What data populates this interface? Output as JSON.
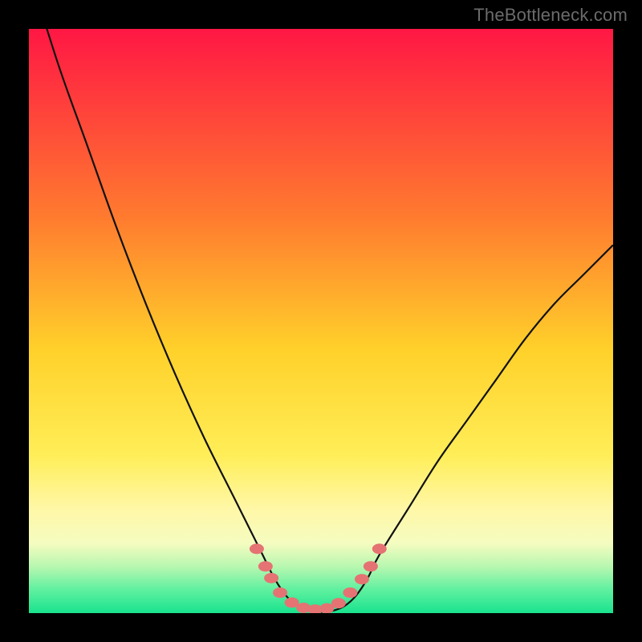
{
  "watermark": "TheBottleneck.com",
  "colors": {
    "bg_top": "#ff1744",
    "bg_mid_upper": "#ff7a2f",
    "bg_mid": "#ffd12a",
    "bg_lower": "#ffee58",
    "bg_pale": "#fff7a6",
    "bg_paler": "#f5fcc0",
    "bg_green1": "#b8f7b0",
    "bg_green2": "#5ff0a0",
    "bg_green3": "#19e38e",
    "curve": "#111111",
    "marker_fill": "#e57373",
    "marker_stroke": "#d85a5a",
    "frame": "#000000"
  },
  "chart_data": {
    "type": "line",
    "title": "",
    "xlabel": "",
    "ylabel": "",
    "xlim": [
      0,
      100
    ],
    "ylim": [
      0,
      100
    ],
    "series": [
      {
        "name": "bottleneck-curve",
        "x": [
          0,
          5,
          10,
          15,
          20,
          25,
          30,
          35,
          38,
          40,
          42,
          44,
          46,
          48,
          50,
          52,
          54,
          56,
          58,
          60,
          65,
          70,
          75,
          80,
          85,
          90,
          95,
          100
        ],
        "y": [
          110,
          94,
          80,
          66,
          53,
          41,
          30,
          20,
          14,
          10,
          6,
          3,
          1.2,
          0.4,
          0.2,
          0.4,
          1.2,
          3,
          6,
          10,
          18,
          26,
          33,
          40,
          47,
          53,
          58,
          63
        ]
      }
    ],
    "markers": [
      {
        "x": 39,
        "y": 11
      },
      {
        "x": 40.5,
        "y": 8
      },
      {
        "x": 41.5,
        "y": 6
      },
      {
        "x": 43,
        "y": 3.5
      },
      {
        "x": 45,
        "y": 1.8
      },
      {
        "x": 47,
        "y": 0.9
      },
      {
        "x": 49,
        "y": 0.6
      },
      {
        "x": 51,
        "y": 0.8
      },
      {
        "x": 53,
        "y": 1.7
      },
      {
        "x": 55,
        "y": 3.5
      },
      {
        "x": 57,
        "y": 5.8
      },
      {
        "x": 58.5,
        "y": 8
      },
      {
        "x": 60,
        "y": 11
      }
    ],
    "gradient_stops": [
      {
        "pos": 0.0,
        "color_key": "bg_top"
      },
      {
        "pos": 0.32,
        "color_key": "bg_mid_upper"
      },
      {
        "pos": 0.55,
        "color_key": "bg_mid"
      },
      {
        "pos": 0.73,
        "color_key": "bg_lower"
      },
      {
        "pos": 0.82,
        "color_key": "bg_pale"
      },
      {
        "pos": 0.88,
        "color_key": "bg_paler"
      },
      {
        "pos": 0.92,
        "color_key": "bg_green1"
      },
      {
        "pos": 0.96,
        "color_key": "bg_green2"
      },
      {
        "pos": 1.0,
        "color_key": "bg_green3"
      }
    ]
  }
}
